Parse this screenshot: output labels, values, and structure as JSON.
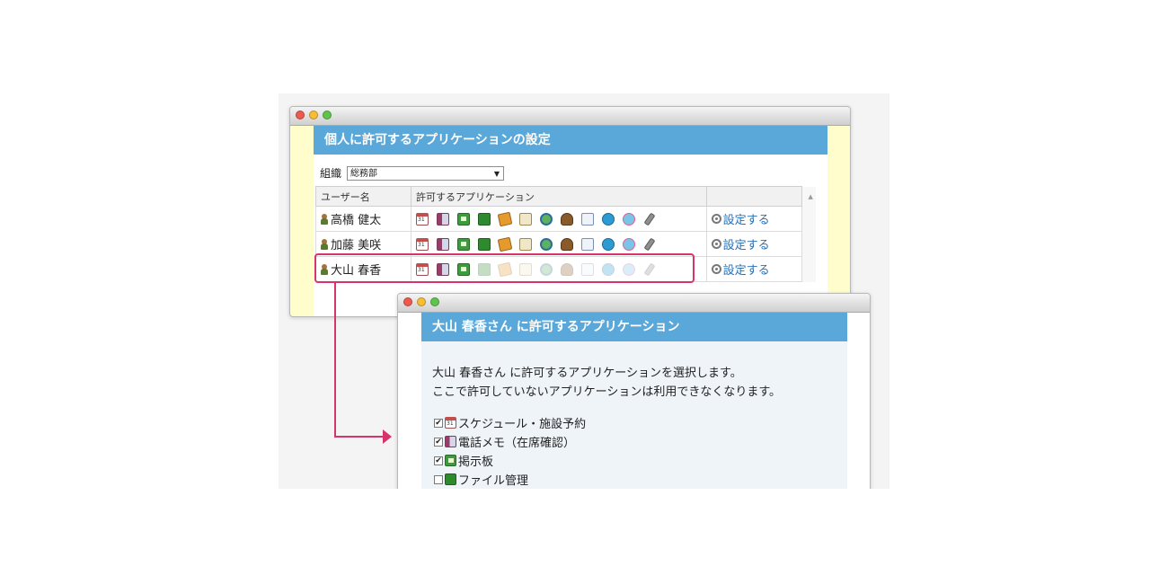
{
  "main_window": {
    "title": "個人に許可するアプリケーションの設定",
    "org_label": "組織",
    "org_select": "総務部",
    "columns": [
      "ユーザー名",
      "許可するアプリケーション"
    ],
    "set_link": "設定する",
    "users": [
      {
        "name": "高橋 健太"
      },
      {
        "name": "加藤 美咲"
      },
      {
        "name": "大山 春香"
      }
    ]
  },
  "dialog": {
    "title": "大山 春香さん に許可するアプリケーション",
    "desc_line1": "大山 春香さん に許可するアプリケーションを選択します。",
    "desc_line2": "ここで許可していないアプリケーションは利用できなくなります。",
    "apps": [
      {
        "label": "スケジュール・施設予約",
        "checked": true,
        "icon": "calendar-icon"
      },
      {
        "label": "電話メモ（在席確認）",
        "checked": true,
        "icon": "phone-memo-icon"
      },
      {
        "label": "掲示板",
        "checked": true,
        "icon": "bulletin-board-icon"
      },
      {
        "label": "ファイル管理",
        "checked": false,
        "icon": "file-management-icon"
      }
    ]
  },
  "app_icons": [
    "calendar-icon",
    "phone-memo-icon",
    "bulletin-board-icon",
    "file-icon",
    "memo-icon",
    "report-icon",
    "search-icon",
    "facility-icon",
    "document-icon",
    "group-icon",
    "workflow-icon",
    "tool-icon"
  ],
  "colors": {
    "header": "#5aa7d9",
    "highlight": "#d6346a",
    "link": "#2b6fb3"
  }
}
